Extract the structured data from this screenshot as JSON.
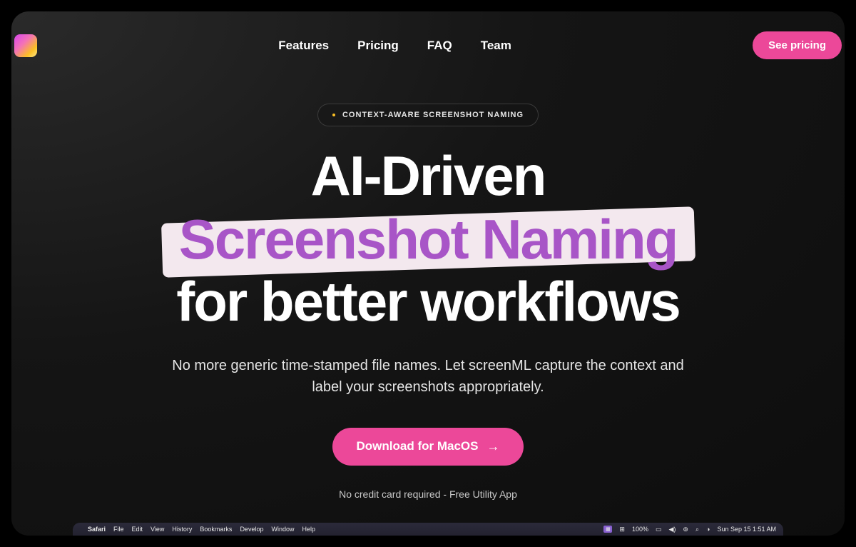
{
  "nav": {
    "items": [
      {
        "label": "Features"
      },
      {
        "label": "Pricing"
      },
      {
        "label": "FAQ"
      },
      {
        "label": "Team"
      }
    ],
    "cta": "See pricing"
  },
  "hero": {
    "pill": "CONTEXT-AWARE SCREENSHOT NAMING",
    "line1": "AI-Driven",
    "line2": "Screenshot Naming",
    "line3": "for better workflows",
    "subtitle": "No more generic time-stamped file names. Let screenML capture the context and label your screenshots appropriately.",
    "download": "Download for MacOS",
    "disclaimer": "No credit card required - Free Utility App"
  },
  "menubar": {
    "app": "Safari",
    "items": [
      "File",
      "Edit",
      "View",
      "History",
      "Bookmarks",
      "Develop",
      "Window",
      "Help"
    ],
    "battery": "100%",
    "datetime": "Sun Sep 15  1:51 AM"
  }
}
